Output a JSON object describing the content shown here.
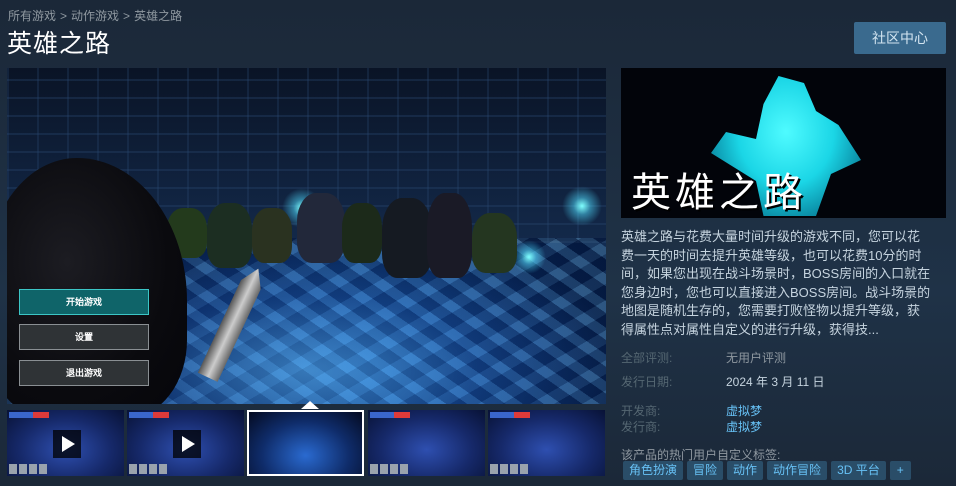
{
  "breadcrumb": {
    "items": [
      "所有游戏",
      "动作游戏",
      "英雄之路"
    ],
    "separator": ">"
  },
  "page_title": "英雄之路",
  "community_hub_button": "社区中心",
  "game_menu": {
    "start": "开始游戏",
    "settings": "设置",
    "quit": "退出游戏"
  },
  "thumbnails": [
    {
      "type": "video"
    },
    {
      "type": "video"
    },
    {
      "type": "image",
      "selected": true
    },
    {
      "type": "image"
    },
    {
      "type": "image"
    }
  ],
  "capsule": {
    "logo_text": "英雄之路"
  },
  "description": "英雄之路与花费大量时间升级的游戏不同，您可以花费一天的时间去提升英雄等级，也可以花费10分的时间，如果您出现在战斗场景时，BOSS房间的入口就在您身边时，您也可以直接进入BOSS房间。战斗场景的地图是随机生存的，您需要打败怪物以提升等级，获得属性点对属性自定义的进行升级，获得技...",
  "info": {
    "reviews_label": "全部评测:",
    "reviews_value": "无用户评测",
    "release_label": "发行日期:",
    "release_value": "2024 年 3 月 11 日",
    "developer_label": "开发商:",
    "developer_value": "虚拟梦",
    "publisher_label": "发行商:",
    "publisher_value": "虚拟梦"
  },
  "tags_label": "该产品的热门用户自定义标签:",
  "tags": [
    "角色扮演",
    "冒险",
    "动作",
    "动作冒险",
    "3D 平台",
    "+"
  ],
  "colors": {
    "background": "#1b2838",
    "link": "#66c0f4",
    "tag_bg": "#2a4d68",
    "button": "#3a6a8e"
  }
}
